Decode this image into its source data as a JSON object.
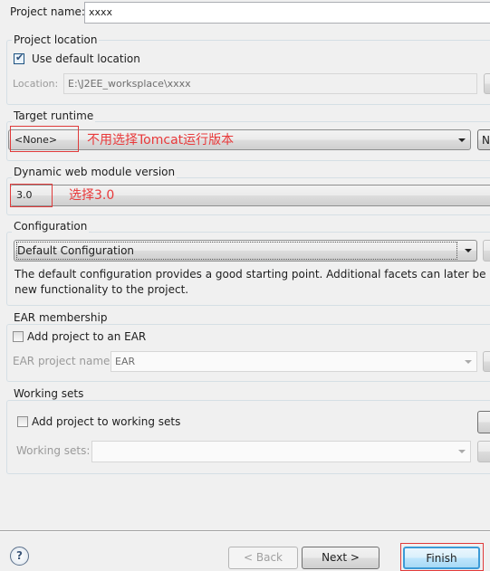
{
  "project_name": {
    "label": "Project name:",
    "value": "xxxx"
  },
  "project_location": {
    "title": "Project location",
    "use_default_label": "Use default location",
    "use_default_checked": true,
    "location_label": "Location:",
    "location_value": "E:\\J2EE_worksplace\\xxxx"
  },
  "target_runtime": {
    "title": "Target runtime",
    "selected": "<None>",
    "annotation": "不用选择Tomcat运行版本",
    "new_button": "N"
  },
  "web_module": {
    "title": "Dynamic web module version",
    "selected": "3.0",
    "annotation": "选择3.0"
  },
  "configuration": {
    "title": "Configuration",
    "selected": "Default Configuration",
    "description_line1": "The default configuration provides a good starting point. Additional facets can later be ins",
    "description_line2": "new functionality to the project."
  },
  "ear": {
    "title": "EAR membership",
    "add_label": "Add project to an EAR",
    "add_checked": false,
    "name_label": "EAR project name:",
    "name_value": "EAR"
  },
  "working_sets": {
    "title": "Working sets",
    "add_label": "Add project to working sets",
    "add_checked": false,
    "sets_label": "Working sets:",
    "sets_value": ""
  },
  "footer": {
    "back": "< Back",
    "next": "Next >",
    "finish": "Finish"
  },
  "colors": {
    "annotation": "#e8393a"
  }
}
